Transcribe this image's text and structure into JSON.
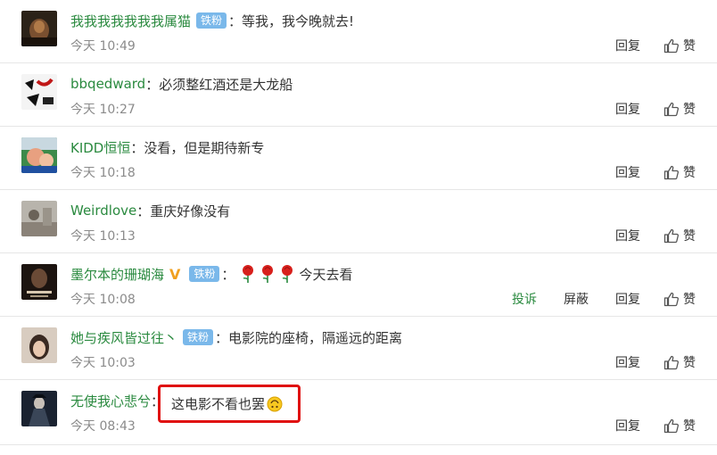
{
  "comments": [
    {
      "username": "我我我我我我我属猫",
      "badge": "铁粉",
      "text": "等我，我今晚就去!",
      "time": "今天 10:49",
      "avatar": "dark-face"
    },
    {
      "username": "bbqedward",
      "badge": "",
      "text": "必须整红酒还是大龙船",
      "time": "今天 10:27",
      "avatar": "calligraphy"
    },
    {
      "username": "KIDD恒恒",
      "badge": "",
      "text": "没看，但是期待新专",
      "time": "今天 10:18",
      "avatar": "cartoon"
    },
    {
      "username": "Weirdlove",
      "badge": "",
      "text": "重庆好像没有",
      "time": "今天 10:13",
      "avatar": "photo-grey"
    },
    {
      "username": "墨尔本的珊瑚海",
      "badge": "铁粉",
      "text": "今天去看",
      "time": "今天 10:08",
      "avatar": "poster",
      "vip": true,
      "roses": 3
    },
    {
      "username": "她与疾风皆过往丶",
      "badge": "铁粉",
      "text": "电影院的座椅，隔遥远的距离",
      "time": "今天 10:03",
      "avatar": "portrait"
    },
    {
      "username": "无使我心悲兮",
      "badge": "",
      "text": "这电影不看也罢",
      "time": "今天 08:43",
      "avatar": "ink-figure",
      "highlighted": true
    }
  ],
  "actions": {
    "report": "投诉",
    "block": "屏蔽",
    "reply": "回复",
    "like": "赞"
  },
  "colors": {
    "username": "#2a8a3f",
    "badge": "#7ab8ea",
    "highlight_border": "#e01010",
    "vip": "#f0a020"
  },
  "icons": {
    "like": "thumbs-up-icon",
    "rose": "rose-icon",
    "emoji": "upside-down-smile-icon"
  }
}
